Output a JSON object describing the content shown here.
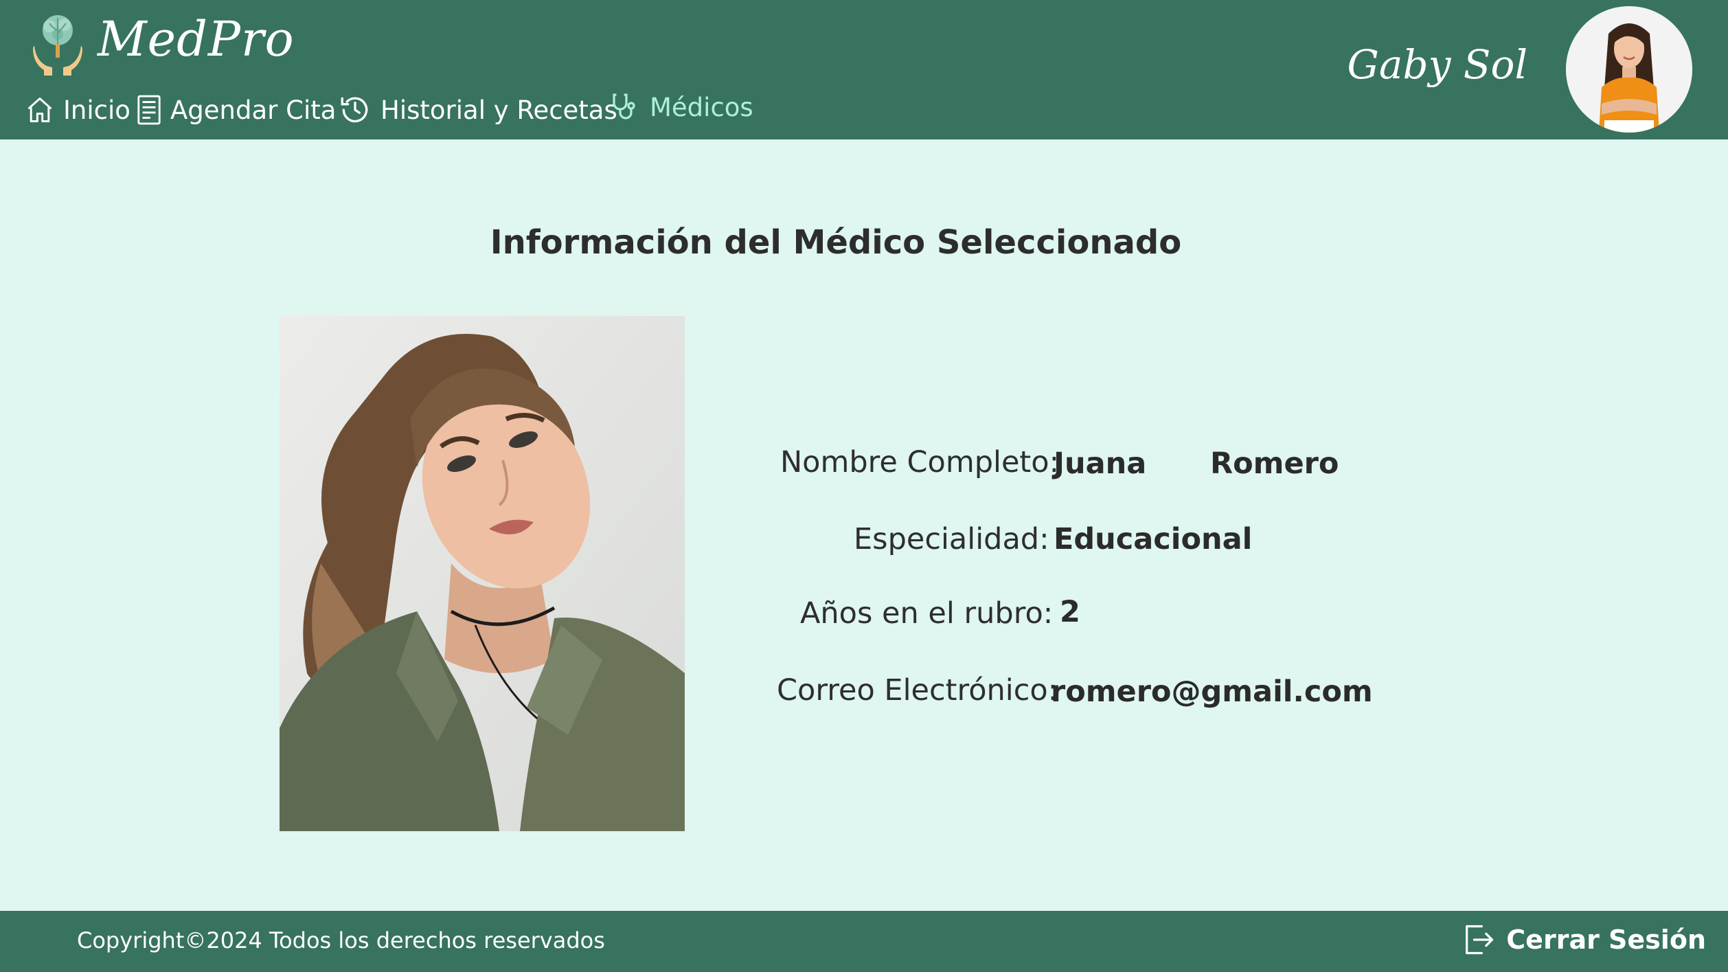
{
  "header": {
    "brand": "MedPro",
    "user_name": "Gaby Sol",
    "colors": {
      "background": "#37735e",
      "nav_active": "#aef0d7"
    },
    "nav": [
      {
        "label": "Inicio",
        "icon": "home-icon"
      },
      {
        "label": "Agendar Cita",
        "icon": "document-icon"
      },
      {
        "label": "Historial y Recetas",
        "icon": "history-icon"
      },
      {
        "label": "Médicos",
        "icon": "stethoscope-icon",
        "active": true
      }
    ]
  },
  "main": {
    "title": "Información del Médico Seleccionado",
    "doctor": {
      "name_label": "Nombre Completo:",
      "first_name": "Juana",
      "last_name": "Romero",
      "specialty_label": "Especialidad:",
      "specialty": "Educacional",
      "years_label": "Años en el rubro:",
      "years": "2",
      "email_label": "Correo Electrónico:",
      "email": "romero@gmail.com"
    }
  },
  "footer": {
    "copyright": "Copyright©2024 Todos los derechos reservados",
    "logout_label": "Cerrar Sesión",
    "logout_icon": "logout-icon"
  }
}
